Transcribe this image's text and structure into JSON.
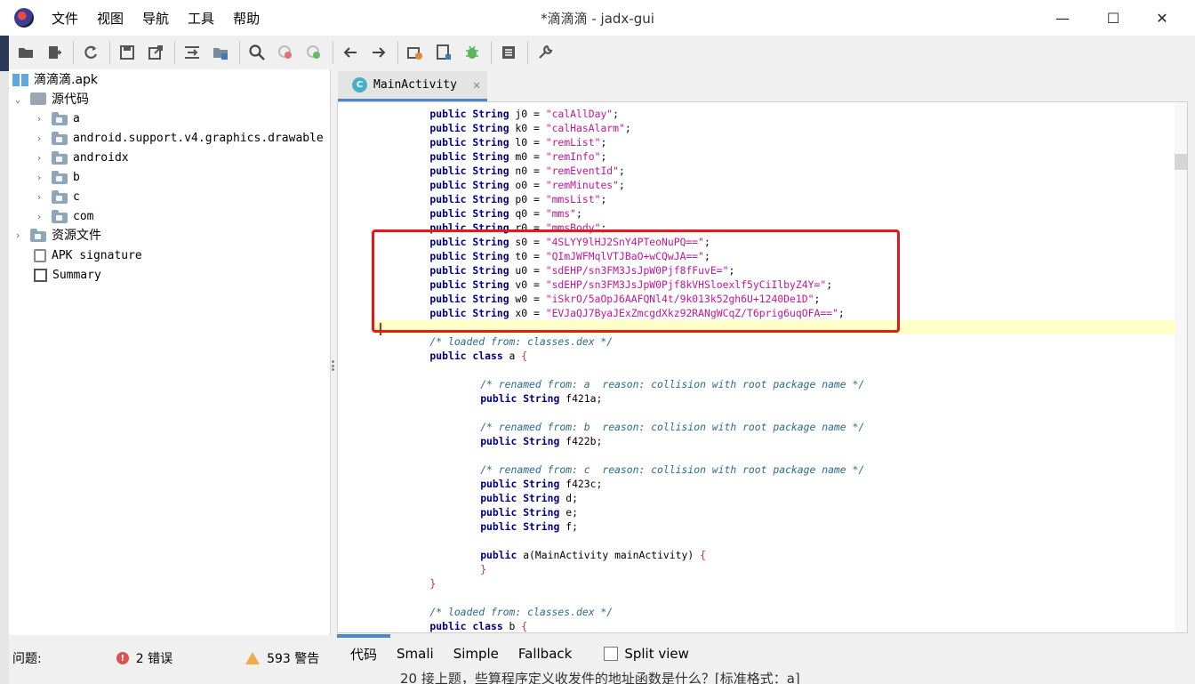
{
  "window": {
    "title": "*滴滴滴 - jadx-gui",
    "menu": [
      "文件",
      "视图",
      "导航",
      "工具",
      "帮助"
    ],
    "controls": {
      "minimize": "—",
      "maximize": "☐",
      "close": "✕"
    }
  },
  "toolbar": {
    "icons": [
      "open-folder-icon",
      "add-files-icon",
      "reload-icon",
      "save-icon",
      "export-icon",
      "sync-icon",
      "deobfuscation-icon",
      "search-icon",
      "class-search-icon",
      "usage-search-icon",
      "back-arrow-icon",
      "forward-arrow-icon",
      "settings-log-icon",
      "log-viewer-icon",
      "debug-bug-icon",
      "list-icon",
      "wrench-icon"
    ]
  },
  "tree": {
    "root": "滴滴滴.apk",
    "source": "源代码",
    "packages": [
      "a",
      "android.support.v4.graphics.drawable",
      "androidx",
      "b",
      "c",
      "com"
    ],
    "resources": "资源文件",
    "signature": "APK signature",
    "summary": "Summary"
  },
  "editor": {
    "tab_label": "MainActivity",
    "tab_icon_letter": "C",
    "close_glyph": "✕",
    "code": [
      {
        "ind": "  ",
        "kind": "field",
        "name": "j0",
        "value": "\"calAllDay\""
      },
      {
        "ind": "  ",
        "kind": "field",
        "name": "k0",
        "value": "\"calHasAlarm\""
      },
      {
        "ind": "  ",
        "kind": "field",
        "name": "l0",
        "value": "\"remList\""
      },
      {
        "ind": "  ",
        "kind": "field",
        "name": "m0",
        "value": "\"remInfo\""
      },
      {
        "ind": "  ",
        "kind": "field",
        "name": "n0",
        "value": "\"remEventId\""
      },
      {
        "ind": "  ",
        "kind": "field",
        "name": "o0",
        "value": "\"remMinutes\""
      },
      {
        "ind": "  ",
        "kind": "field",
        "name": "p0",
        "value": "\"mmsList\""
      },
      {
        "ind": "  ",
        "kind": "field",
        "name": "q0",
        "value": "\"mms\""
      },
      {
        "ind": "  ",
        "kind": "field",
        "name": "r0",
        "value": "\"mmsBody\""
      },
      {
        "ind": "  ",
        "kind": "field",
        "name": "s0",
        "value": "\"4SLYY9lHJ2SnY4PTeoNuPQ==\""
      },
      {
        "ind": "  ",
        "kind": "field",
        "name": "t0",
        "value": "\"QImJWFMqlVTJBaO+wCQwJA==\""
      },
      {
        "ind": "  ",
        "kind": "field",
        "name": "u0",
        "value": "\"sdEHP/sn3FM3JsJpW0Pjf8fFuvE=\""
      },
      {
        "ind": "  ",
        "kind": "field",
        "name": "v0",
        "value": "\"sdEHP/sn3FM3JsJpW0Pjf8kVHSloexlf5yCiIlbyZ4Y=\""
      },
      {
        "ind": "  ",
        "kind": "field",
        "name": "w0",
        "value": "\"iSkrO/5aOpJ6AAFQNl4t/9k013k52gh6U+1240De1D\""
      },
      {
        "ind": "  ",
        "kind": "field",
        "name": "x0",
        "value": "\"EVJaQJ7ByaJExZmcgdXkz92RANgWCqZ/T6prig6uqOFA==\""
      },
      {
        "ind": "",
        "kind": "blank"
      },
      {
        "ind": "  ",
        "kind": "comment",
        "text": "/* loaded from: classes.dex */"
      },
      {
        "ind": "  ",
        "kind": "classdecl",
        "name": "a"
      },
      {
        "ind": "",
        "kind": "blank"
      },
      {
        "ind": "      ",
        "kind": "comment",
        "text": "/* renamed from: a  reason: collision with root package name */"
      },
      {
        "ind": "      ",
        "kind": "decl",
        "name": "f421a"
      },
      {
        "ind": "",
        "kind": "blank"
      },
      {
        "ind": "      ",
        "kind": "comment",
        "text": "/* renamed from: b  reason: collision with root package name */"
      },
      {
        "ind": "      ",
        "kind": "decl",
        "name": "f422b"
      },
      {
        "ind": "",
        "kind": "blank"
      },
      {
        "ind": "      ",
        "kind": "comment",
        "text": "/* renamed from: c  reason: collision with root package name */"
      },
      {
        "ind": "      ",
        "kind": "decl",
        "name": "f423c"
      },
      {
        "ind": "      ",
        "kind": "decl",
        "name": "d"
      },
      {
        "ind": "      ",
        "kind": "decl",
        "name": "e"
      },
      {
        "ind": "      ",
        "kind": "decl",
        "name": "f"
      },
      {
        "ind": "",
        "kind": "blank"
      },
      {
        "ind": "      ",
        "kind": "ctor",
        "name": "a",
        "param": "MainActivity mainActivity"
      },
      {
        "ind": "      ",
        "kind": "brace",
        "text": "}"
      },
      {
        "ind": "  ",
        "kind": "brace",
        "text": "}"
      },
      {
        "ind": "",
        "kind": "blank"
      },
      {
        "ind": "  ",
        "kind": "comment",
        "text": "/* loaded from: classes.dex */"
      },
      {
        "ind": "  ",
        "kind": "classdecl",
        "name": "b"
      }
    ],
    "keywords": {
      "public": "public",
      "string": "String",
      "class": "class"
    }
  },
  "view_tabs": [
    "代码",
    "Smali",
    "Simple",
    "Fallback"
  ],
  "split_view": {
    "label": "Split view",
    "checked": false
  },
  "status": {
    "problems_label": "问题:",
    "errors": "2 错误",
    "warnings": "593 警告"
  },
  "bottom_text": "20 接上题，些算程序定义收发件的地址函数是什么？[标准格式：a]"
}
